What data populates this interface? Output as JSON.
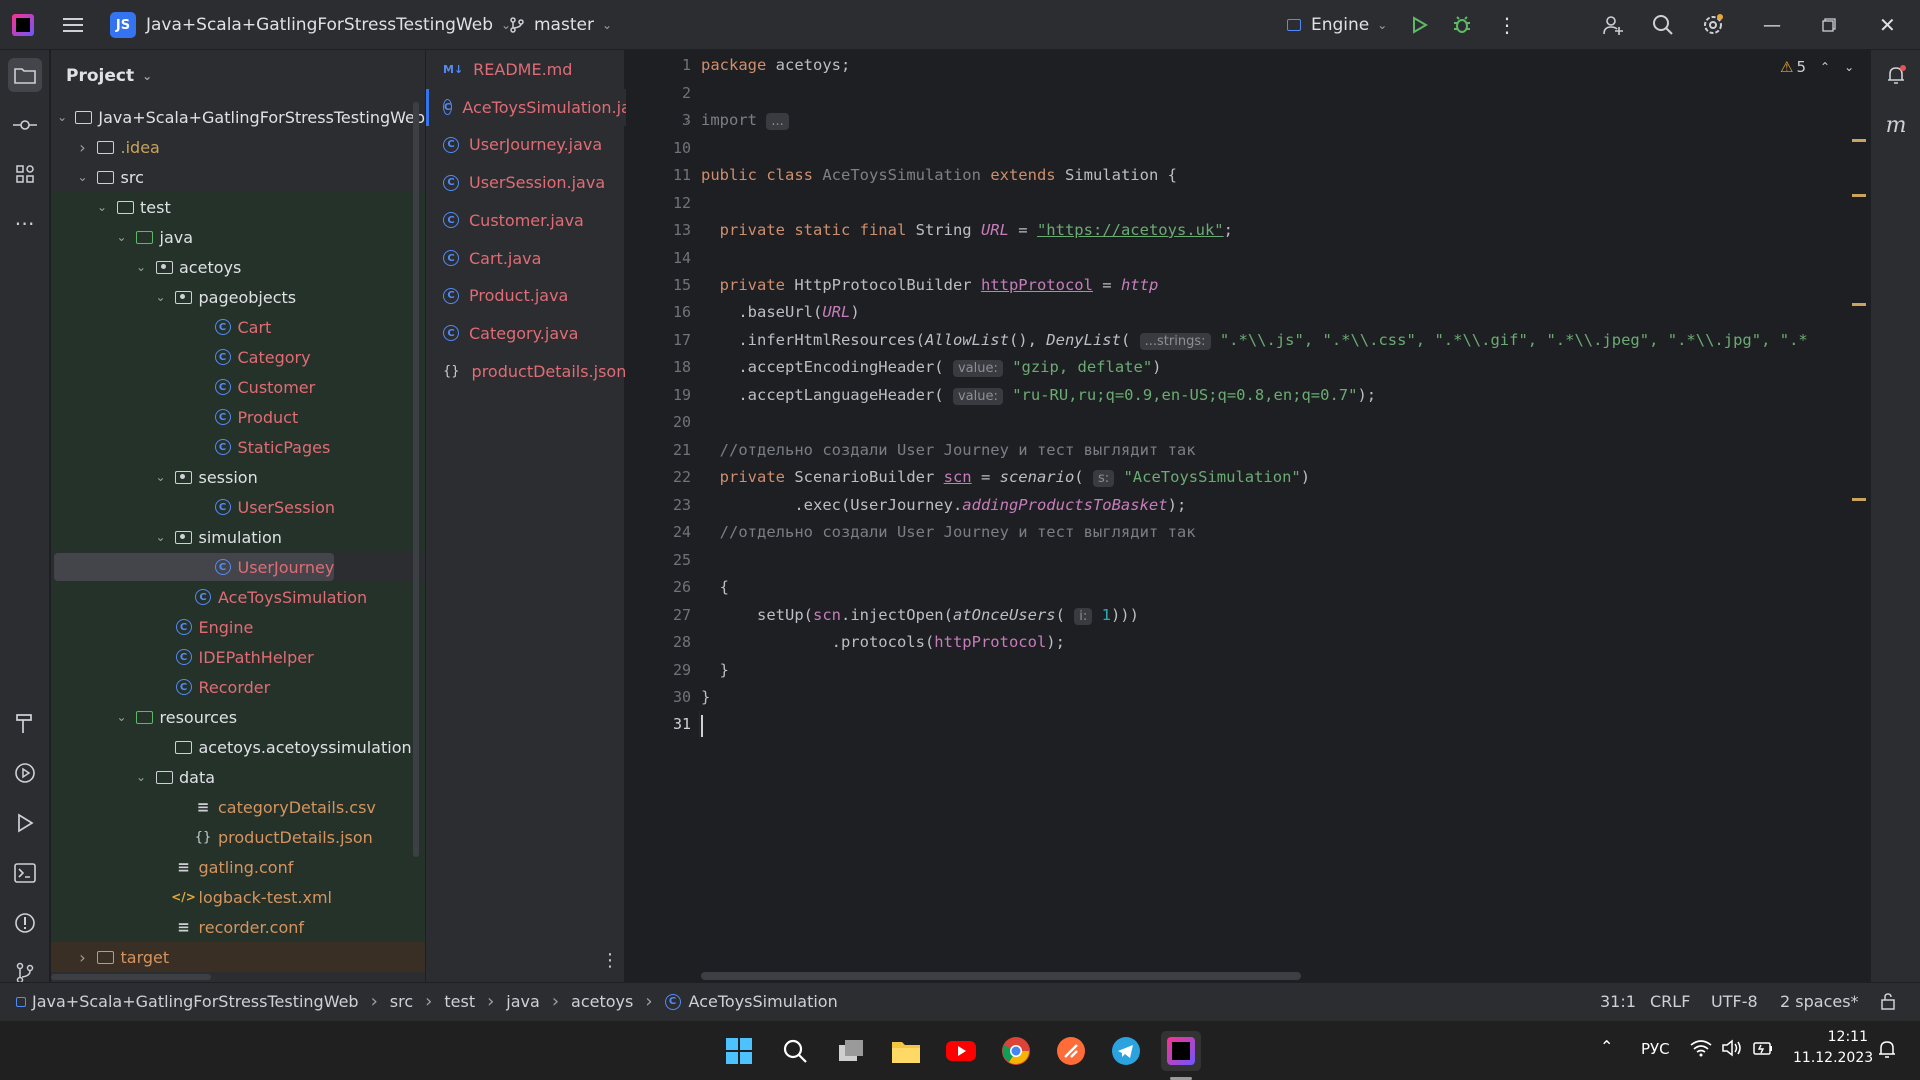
{
  "titlebar": {
    "project_badge": "JS",
    "project_name": "Java+Scala+GatlingForStressTestingWeb",
    "branch": "master",
    "run_config": "Engine",
    "warnings_count": "5"
  },
  "project_panel": {
    "title": "Project",
    "tree": [
      {
        "label": "Java+Scala+GatlingForStressTestingWeb",
        "depth": 0,
        "arrow": "open",
        "icon": "folder"
      },
      {
        "label": ".idea",
        "depth": 1,
        "arrow": "closed",
        "icon": "folder"
      },
      {
        "label": "src",
        "depth": 1,
        "arrow": "open",
        "icon": "folder"
      },
      {
        "label": "test",
        "depth": 2,
        "arrow": "open",
        "icon": "folder"
      },
      {
        "label": "java",
        "depth": 3,
        "arrow": "open",
        "icon": "folder-green"
      },
      {
        "label": "acetoys",
        "depth": 4,
        "arrow": "open",
        "icon": "package"
      },
      {
        "label": "pageobjects",
        "depth": 5,
        "arrow": "open",
        "icon": "package"
      },
      {
        "label": "Cart",
        "depth": 7,
        "arrow": "none",
        "icon": "class"
      },
      {
        "label": "Category",
        "depth": 7,
        "arrow": "none",
        "icon": "class"
      },
      {
        "label": "Customer",
        "depth": 7,
        "arrow": "none",
        "icon": "class"
      },
      {
        "label": "Product",
        "depth": 7,
        "arrow": "none",
        "icon": "class"
      },
      {
        "label": "StaticPages",
        "depth": 7,
        "arrow": "none",
        "icon": "class"
      },
      {
        "label": "session",
        "depth": 5,
        "arrow": "open",
        "icon": "package"
      },
      {
        "label": "UserSession",
        "depth": 7,
        "arrow": "none",
        "icon": "class"
      },
      {
        "label": "simulation",
        "depth": 5,
        "arrow": "open",
        "icon": "package"
      },
      {
        "label": "UserJourney",
        "depth": 7,
        "arrow": "none",
        "icon": "class"
      },
      {
        "label": "AceToysSimulation",
        "depth": 6,
        "arrow": "none",
        "icon": "class"
      },
      {
        "label": "Engine",
        "depth": 5,
        "arrow": "none",
        "icon": "class"
      },
      {
        "label": "IDEPathHelper",
        "depth": 5,
        "arrow": "none",
        "icon": "class"
      },
      {
        "label": "Recorder",
        "depth": 5,
        "arrow": "none",
        "icon": "class"
      },
      {
        "label": "resources",
        "depth": 3,
        "arrow": "open",
        "icon": "folder-res"
      },
      {
        "label": "acetoys.acetoyssimulation",
        "depth": 5,
        "arrow": "none",
        "icon": "folder"
      },
      {
        "label": "data",
        "depth": 4,
        "arrow": "open",
        "icon": "folder"
      },
      {
        "label": "categoryDetails.csv",
        "depth": 6,
        "arrow": "none",
        "icon": "text"
      },
      {
        "label": "productDetails.json",
        "depth": 6,
        "arrow": "none",
        "icon": "json"
      },
      {
        "label": "gatling.conf",
        "depth": 5,
        "arrow": "none",
        "icon": "text"
      },
      {
        "label": "logback-test.xml",
        "depth": 5,
        "arrow": "none",
        "icon": "xml"
      },
      {
        "label": "recorder.conf",
        "depth": 5,
        "arrow": "none",
        "icon": "text"
      },
      {
        "label": "target",
        "depth": 1,
        "arrow": "closed",
        "icon": "folder-orange"
      }
    ]
  },
  "tabs": [
    {
      "label": "README.md",
      "icon": "md",
      "active": false
    },
    {
      "label": "AceToysSimulation.java",
      "icon": "class",
      "active": true
    },
    {
      "label": "UserJourney.java",
      "icon": "class",
      "active": false
    },
    {
      "label": "UserSession.java",
      "icon": "class",
      "active": false
    },
    {
      "label": "Customer.java",
      "icon": "class",
      "active": false
    },
    {
      "label": "Cart.java",
      "icon": "class",
      "active": false
    },
    {
      "label": "Product.java",
      "icon": "class",
      "active": false
    },
    {
      "label": "Category.java",
      "icon": "class",
      "active": false
    },
    {
      "label": "productDetails.json",
      "icon": "json",
      "active": false
    }
  ],
  "editor": {
    "line_numbers": [
      "1",
      "2",
      "3",
      "10",
      "11",
      "12",
      "13",
      "14",
      "15",
      "16",
      "17",
      "18",
      "19",
      "20",
      "21",
      "22",
      "23",
      "24",
      "25",
      "26",
      "27",
      "28",
      "29",
      "30",
      "31"
    ],
    "current_line": "31",
    "code": {
      "l1_kw": "package",
      "l1_rest": " acetoys;",
      "l3_kw": "import",
      "l3_fold": "...",
      "l11_kw1": "public class",
      "l11_name": "AceToysSimulation",
      "l11_kw2": "extends",
      "l11_rest": " Simulation {",
      "l13_kw": "  private static final",
      "l13_type": " String ",
      "l13_fld": "URL",
      "l13_eq": " = ",
      "l13_str": "\"https://acetoys.uk\"",
      "l13_end": ";",
      "l15_kw": "  private",
      "l15_type": " HttpProtocolBuilder ",
      "l15_fld": "httpProtocol",
      "l15_eq": " = ",
      "l15_http": "http",
      "l16_a": "    .baseUrl(",
      "l16_fld": "URL",
      "l16_b": ")",
      "l17_a": "    .inferHtmlResources(",
      "l17_b": "AllowList",
      "l17_c": "(), ",
      "l17_d": "DenyList",
      "l17_e": "( ",
      "l17_hint": "...strings:",
      "l17_str": " \".*\\\\.js\", \".*\\\\.css\", \".*\\\\.gif\", \".*\\\\.jpeg\", \".*\\\\.jpg\", \".*",
      "l18_a": "    .acceptEncodingHeader( ",
      "l18_hint": "value:",
      "l18_str": " \"gzip, deflate\"",
      "l18_b": ")",
      "l19_a": "    .acceptLanguageHeader( ",
      "l19_hint": "value:",
      "l19_str": " \"ru-RU,ru;q=0.9,en-US;q=0.8,en;q=0.7\"",
      "l19_b": ");",
      "l21_cm": "  //отдельно создали User Journey и тест выглядит так",
      "l22_kw": "  private",
      "l22_type": " ScenarioBuilder ",
      "l22_fld": "scn",
      "l22_eq": " = ",
      "l22_fn": "scenario",
      "l22_p": "( ",
      "l22_hint": "s:",
      "l22_str": " \"AceToysSimulation\"",
      "l22_end": ")",
      "l23_a": "          .exec(UserJourney.",
      "l23_fld": "addingProductsToBasket",
      "l23_b": ");",
      "l24_cm": "  //отдельно создали User Journey и тест выглядит так",
      "l26": "  {",
      "l27_a": "      setUp(",
      "l27_fld": "scn",
      "l27_b": ".injectOpen(",
      "l27_fn": "atOnceUsers",
      "l27_c": "( ",
      "l27_hint": "i:",
      "l27_num": " 1",
      "l27_d": ")))",
      "l28_a": "              .protocols(",
      "l28_fld": "httpProtocol",
      "l28_b": ");",
      "l29": "  }",
      "l30": "}"
    }
  },
  "statusbar": {
    "breadcrumbs": [
      "Java+Scala+GatlingForStressTestingWeb",
      "src",
      "test",
      "java",
      "acetoys",
      "AceToysSimulation"
    ],
    "position": "31:1",
    "line_sep": "CRLF",
    "encoding": "UTF-8",
    "indent": "2 spaces*"
  },
  "taskbar": {
    "lang": "РУС",
    "time": "12:11",
    "date": "11.12.2023"
  },
  "colors": {
    "accent": "#3574f0",
    "keyword": "#cf8e6d",
    "string": "#6aab73",
    "field": "#c77dbb",
    "modified_file": "#e06c75"
  }
}
